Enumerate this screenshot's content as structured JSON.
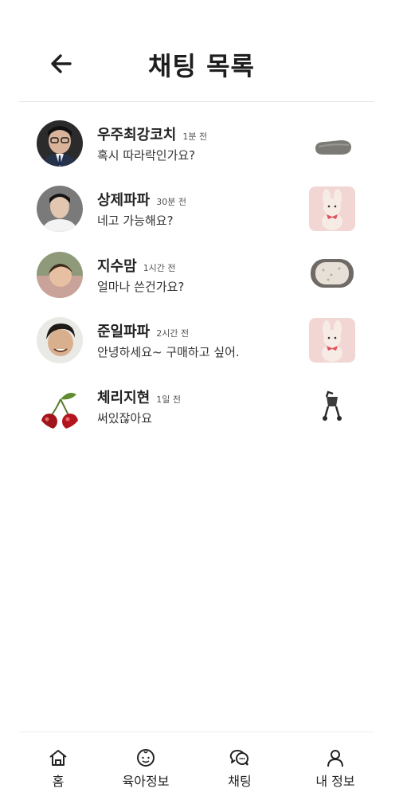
{
  "header": {
    "title": "채팅 목록",
    "back_icon": "arrow-left-icon"
  },
  "chats": [
    {
      "name": "우주최강코치",
      "time": "1분 전",
      "message": "혹시 따라락인가요?",
      "thumbnail": "car-seat-cushion"
    },
    {
      "name": "상제파파",
      "time": "30분 전",
      "message": "네고 가능해요?",
      "thumbnail": "pink-bunny-plush"
    },
    {
      "name": "지수맘",
      "time": "1시간 전",
      "message": "얼마나 쓴건가요?",
      "thumbnail": "baby-bath-mat"
    },
    {
      "name": "준일파파",
      "time": "2시간 전",
      "message": "안녕하세요~ 구매하고 싶어.",
      "thumbnail": "pink-bunny-plush"
    },
    {
      "name": "체리지현",
      "time": "1일 전",
      "message": "써있잖아요",
      "thumbnail": "stroller"
    }
  ],
  "nav": [
    {
      "label": "홈",
      "icon": "home-icon"
    },
    {
      "label": "육아정보",
      "icon": "baby-face-icon"
    },
    {
      "label": "채팅",
      "icon": "chat-bubbles-icon"
    },
    {
      "label": "내 정보",
      "icon": "user-icon"
    }
  ],
  "colors": {
    "text": "#222222",
    "divider": "#e8e8e8",
    "background": "#ffffff"
  }
}
